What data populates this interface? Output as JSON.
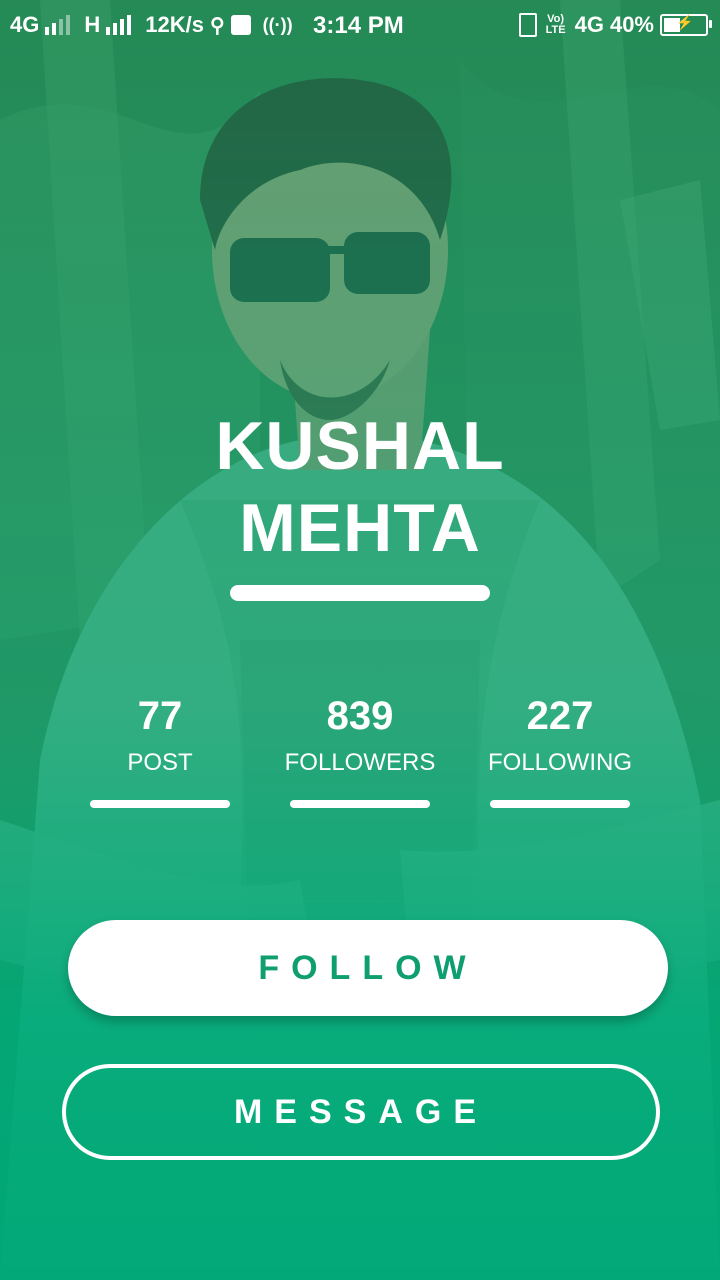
{
  "status_bar": {
    "network_1": "4G",
    "network_2": "H",
    "speed": "12K/s",
    "time": "3:14 PM",
    "volte": "Vo) LTE",
    "network_3": "4G",
    "battery": "40%",
    "icons": [
      "usb-icon",
      "usb-debug-icon",
      "hotspot-icon",
      "vibrate-icon",
      "battery-icon"
    ]
  },
  "profile": {
    "name_line_1": "KUSHAL",
    "name_line_2": "MEHTA"
  },
  "stats": [
    {
      "value": "77",
      "label": "POST"
    },
    {
      "value": "839",
      "label": "FOLLOWERS"
    },
    {
      "value": "227",
      "label": "FOLLOWING"
    }
  ],
  "actions": {
    "follow_label": "FOLLOW",
    "message_label": "MESSAGE"
  },
  "colors": {
    "accent": "#0f9e70",
    "overlay_bottom": "#00a876"
  }
}
